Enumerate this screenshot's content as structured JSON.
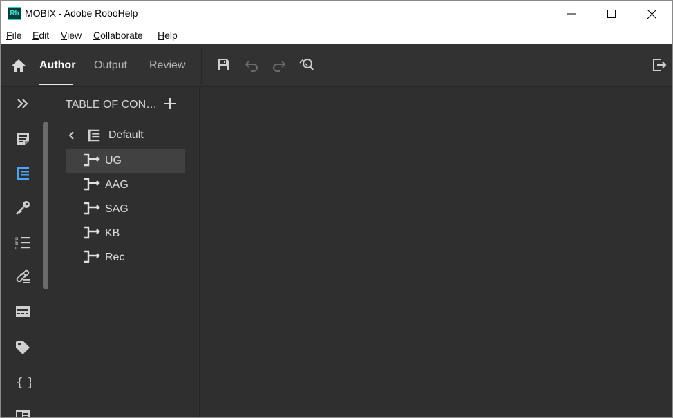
{
  "window": {
    "title": "MOBIX - Adobe RoboHelp",
    "app_icon_text": "Rh",
    "controls": [
      "minimize-icon",
      "maximize-icon",
      "close-icon"
    ]
  },
  "menu": {
    "file": {
      "acc": "F",
      "rest": "ile"
    },
    "edit": {
      "acc": "E",
      "rest": "dit"
    },
    "view": {
      "acc": "V",
      "rest": "iew"
    },
    "collaborate": {
      "acc": "C",
      "rest": "ollaborate"
    },
    "help": {
      "acc": "H",
      "rest": "elp"
    }
  },
  "toolbar": {
    "tabs": [
      "Author",
      "Output",
      "Review"
    ],
    "active_tab": "Author",
    "icons": [
      "home-icon",
      "save-icon",
      "undo-icon",
      "redo-icon",
      "find-replace-icon",
      "exit-icon"
    ]
  },
  "rail": {
    "icons": [
      "expand-icon",
      "contents-icon",
      "toc-icon",
      "key-icon",
      "glossary-icon",
      "links-icon",
      "snippets-icon",
      "tag-icon",
      "variables-icon",
      "card-icon"
    ],
    "active": "toc-icon"
  },
  "toc": {
    "title": "TABLE OF CONTENTS",
    "root": "Default",
    "items": [
      "UG",
      "AAG",
      "SAG",
      "KB",
      "Rec"
    ],
    "selected": "UG"
  },
  "colors": {
    "panel": "#2f2f2f",
    "accent": "#4aa3ff",
    "selection": "#414141"
  }
}
